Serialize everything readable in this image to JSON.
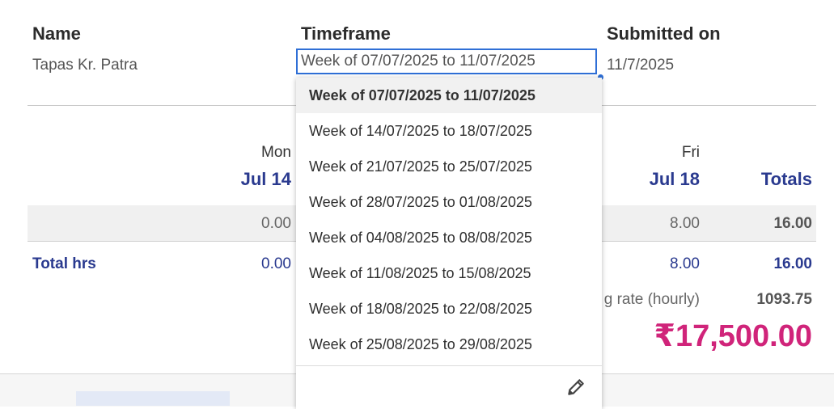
{
  "header": {
    "name_label": "Name",
    "name_value": "Tapas Kr. Patra",
    "timeframe_label": "Timeframe",
    "timeframe_value": "Week of 07/07/2025 to 11/07/2025",
    "submitted_label": "Submitted on",
    "submitted_value": "11/7/2025"
  },
  "columns": {
    "mon_day": "Mon",
    "mon_date": "Jul 14",
    "fri_day": "Fri",
    "fri_date": "Jul 18",
    "totals": "Totals"
  },
  "row": {
    "mon": "0.00",
    "fri": "8.00",
    "total": "16.00"
  },
  "total_row": {
    "label": "Total hrs",
    "mon": "0.00",
    "fri": "8.00",
    "total": "16.00"
  },
  "rate": {
    "label": "g rate (hourly)",
    "value": "1093.75"
  },
  "amount": "₹17,500.00",
  "dropdown": {
    "options": [
      "Week of 07/07/2025 to 11/07/2025",
      "Week of 14/07/2025 to 18/07/2025",
      "Week of 21/07/2025 to 25/07/2025",
      "Week of 28/07/2025 to 01/08/2025",
      "Week of 04/08/2025 to 08/08/2025",
      "Week of 11/08/2025 to 15/08/2025",
      "Week of 18/08/2025 to 22/08/2025",
      "Week of 25/08/2025 to 29/08/2025"
    ],
    "selected_index": 0
  },
  "icons": {
    "edit": "pencil-icon"
  },
  "colors": {
    "accent_blue": "#2a3a8f",
    "focus_blue": "#2f6fd6",
    "amount_pink": "#d0247a"
  }
}
